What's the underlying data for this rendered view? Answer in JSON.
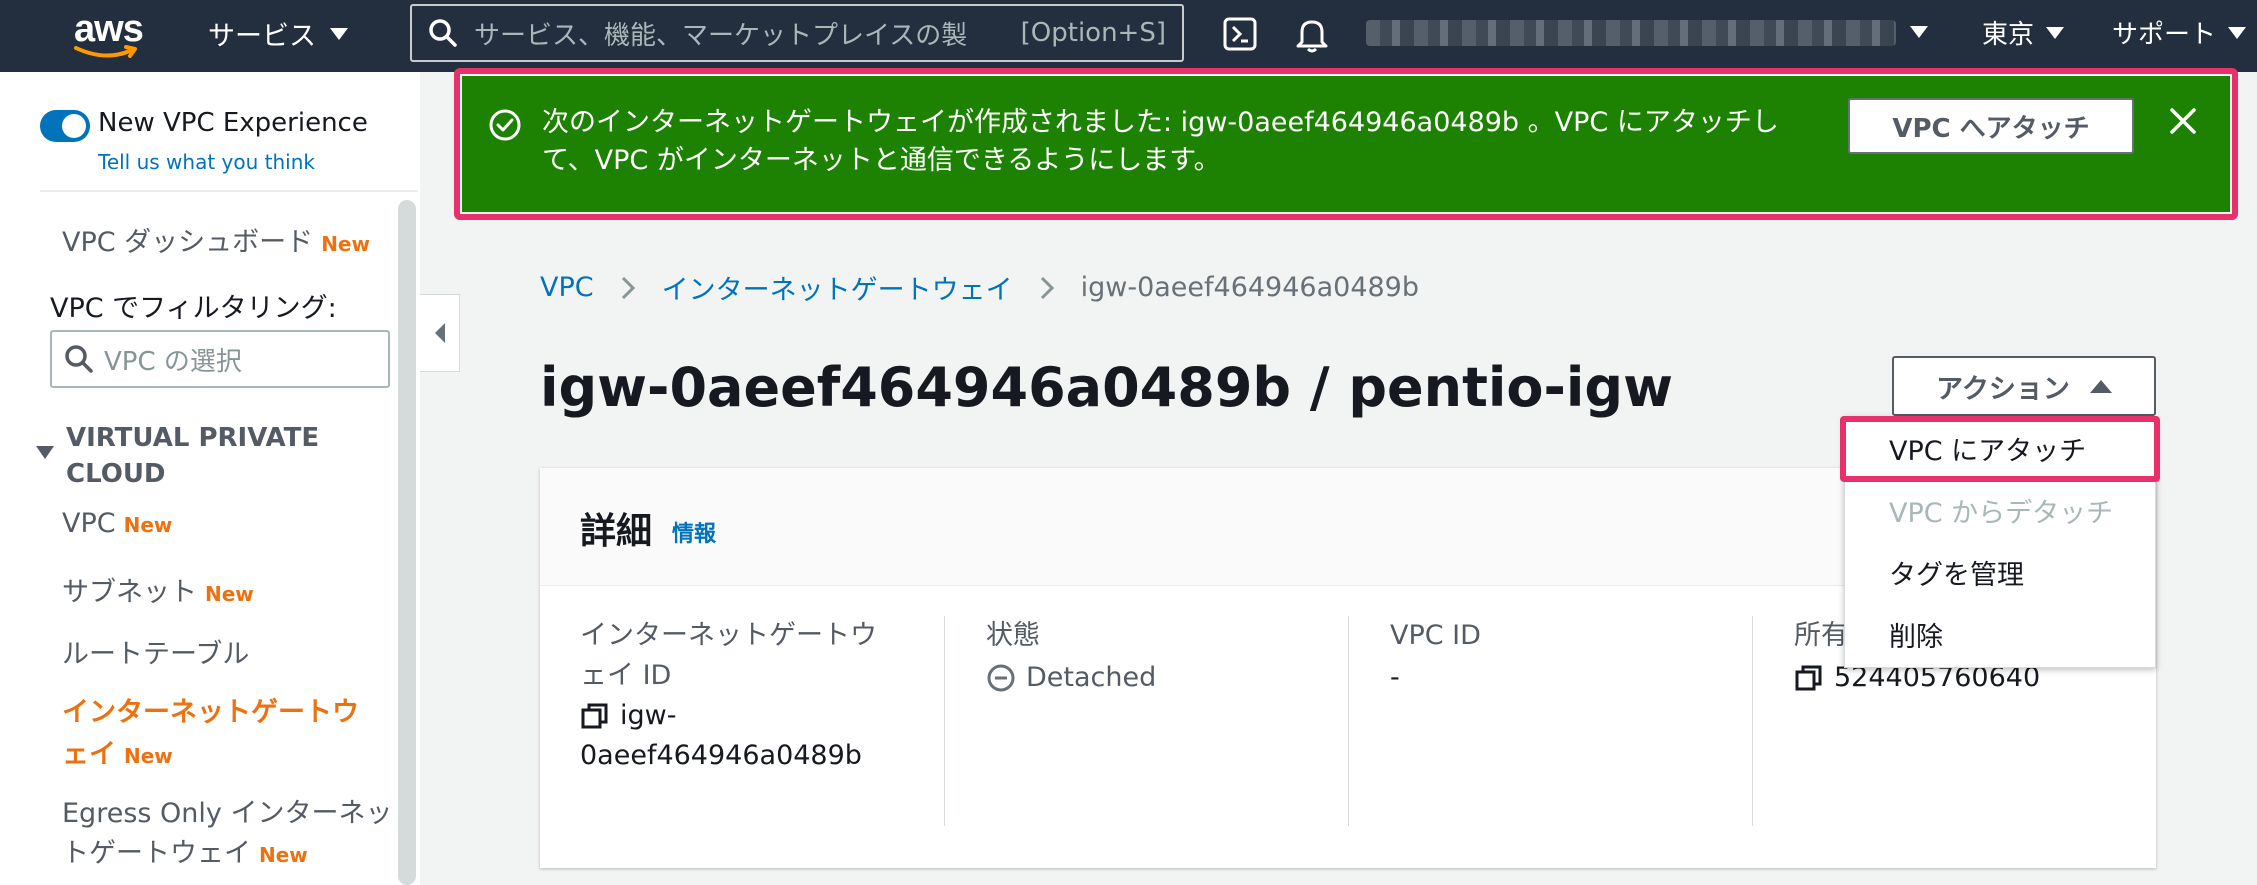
{
  "topnav": {
    "logo_text": "aws",
    "services_label": "サービス",
    "search_placeholder": "サービス、機能、マーケットプレイスの製",
    "search_shortcut": "[Option+S]",
    "region_label": "東京",
    "support_label": "サポート"
  },
  "sidebar": {
    "new_experience_label": "New VPC Experience",
    "tell_us_link": "Tell us what you think",
    "dashboard_label": "VPC ダッシュボード",
    "new_badge": "New",
    "filter_label": "VPC でフィルタリング:",
    "filter_placeholder": "VPC の選択",
    "section_title": "VIRTUAL PRIVATE CLOUD",
    "items": [
      {
        "label": "VPC",
        "badge": "New"
      },
      {
        "label": "サブネット",
        "badge": "New"
      },
      {
        "label": "ルートテーブル",
        "badge": ""
      },
      {
        "label_line1": "インターネットゲートウ",
        "label_line2": "ェイ",
        "badge": "New",
        "active": true
      },
      {
        "label_line1": "Egress Only インターネッ",
        "label_line2": "トゲートウェイ",
        "badge": "New"
      }
    ]
  },
  "flash": {
    "message": "次のインターネットゲートウェイが作成されました: igw-0aeef464946a0489b 。VPC にアタッチして、VPC がインターネットと通信できるようにします。",
    "action_label": "VPC へアタッチ",
    "status_color": "#1d8102"
  },
  "breadcrumb": {
    "items": [
      "VPC",
      "インターネットゲートウェイ",
      "igw-0aeef464946a0489b"
    ]
  },
  "page_title": "igw-0aeef464946a0489b / pentio-igw",
  "actions": {
    "label": "アクション",
    "menu": [
      {
        "label": "VPC にアタッチ",
        "disabled": false
      },
      {
        "label": "VPC からデタッチ",
        "disabled": true
      },
      {
        "label": "タグを管理",
        "disabled": false
      },
      {
        "label": "削除",
        "disabled": false
      }
    ]
  },
  "details": {
    "title": "詳細",
    "info_link": "情報",
    "fields": [
      {
        "label_line1": "インターネットゲートウ",
        "label_line2": "ェイ ID",
        "value_line1": "igw-",
        "value_line2": "0aeef464946a0489b"
      },
      {
        "label": "状態",
        "value": "Detached"
      },
      {
        "label": "VPC ID",
        "value": "-"
      },
      {
        "label": "所有者",
        "value": "524405760640"
      }
    ]
  },
  "colors": {
    "nav_bg": "#232f3e",
    "accent_orange": "#ec7211",
    "link_blue": "#0073bb",
    "highlight_pink": "#e8306a"
  }
}
